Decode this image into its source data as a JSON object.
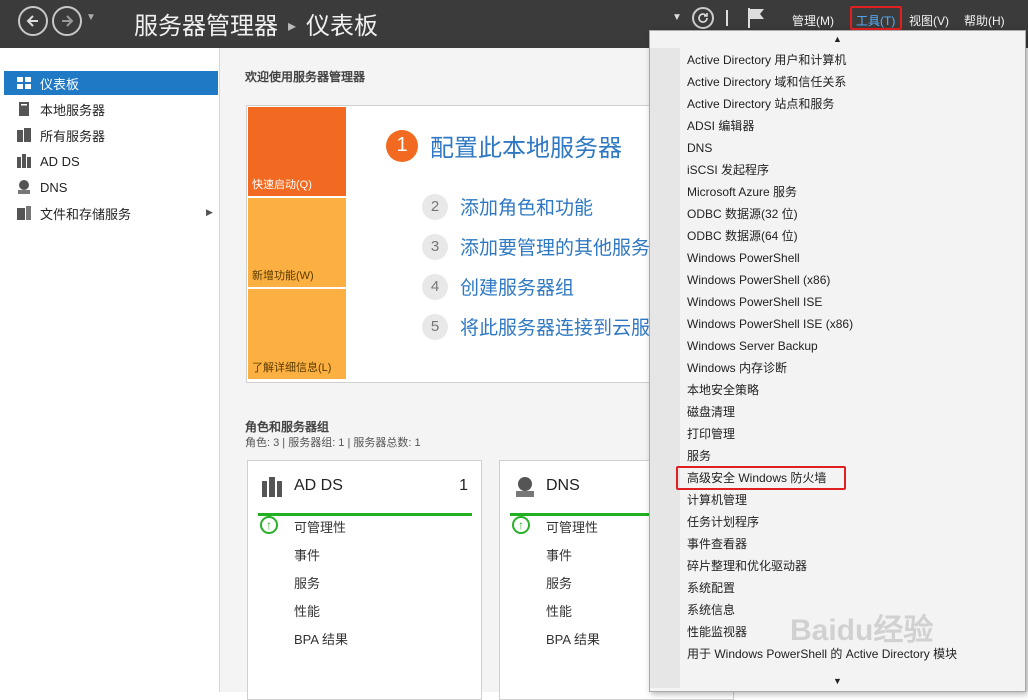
{
  "titlebar": {
    "breadcrumb_root": "服务器管理器",
    "breadcrumb_separator": "▸",
    "breadcrumb_page": "仪表板",
    "menus": {
      "manage": "管理(M)",
      "tools": "工具(T)",
      "view": "视图(V)",
      "help": "帮助(H)"
    }
  },
  "sidebar": {
    "items": [
      {
        "label": "仪表板",
        "icon": "dashboard-icon",
        "active": true
      },
      {
        "label": "本地服务器",
        "icon": "server-icon"
      },
      {
        "label": "所有服务器",
        "icon": "servers-icon"
      },
      {
        "label": "AD DS",
        "icon": "ad-ds-icon"
      },
      {
        "label": "DNS",
        "icon": "dns-icon"
      },
      {
        "label": "文件和存储服务",
        "icon": "file-storage-icon",
        "expandable": true
      }
    ]
  },
  "welcome": {
    "title": "欢迎使用服务器管理器",
    "tiles": [
      "快速启动(Q)",
      "新增功能(W)",
      "了解详细信息(L)"
    ],
    "steps": [
      {
        "num": "1",
        "label": "配置此本地服务器"
      },
      {
        "num": "2",
        "label": "添加角色和功能"
      },
      {
        "num": "3",
        "label": "添加要管理的其他服务"
      },
      {
        "num": "4",
        "label": "创建服务器组"
      },
      {
        "num": "5",
        "label": "将此服务器连接到云服"
      }
    ]
  },
  "roles": {
    "title": "角色和服务器组",
    "subtitle": "角色: 3 | 服务器组: 1 | 服务器总数: 1",
    "cards": [
      {
        "name": "AD DS",
        "count": "1",
        "rows": [
          "可管理性",
          "事件",
          "服务",
          "性能",
          "BPA 结果"
        ]
      },
      {
        "name": "DNS",
        "count": "",
        "rows": [
          "可管理性",
          "事件",
          "服务",
          "性能",
          "BPA 结果"
        ]
      }
    ]
  },
  "tools_menu": {
    "items": [
      "Active Directory 用户和计算机",
      "Active Directory 域和信任关系",
      "Active Directory 站点和服务",
      "ADSI 编辑器",
      "DNS",
      "iSCSI 发起程序",
      "Microsoft Azure 服务",
      "ODBC 数据源(32 位)",
      "ODBC 数据源(64 位)",
      "Windows PowerShell",
      "Windows PowerShell (x86)",
      "Windows PowerShell ISE",
      "Windows PowerShell ISE (x86)",
      "Windows Server Backup",
      "Windows 内存诊断",
      "本地安全策略",
      "磁盘清理",
      "打印管理",
      "服务",
      "高级安全 Windows 防火墙",
      "计算机管理",
      "任务计划程序",
      "事件查看器",
      "碎片整理和优化驱动器",
      "系统配置",
      "系统信息",
      "性能监视器",
      "用于 Windows PowerShell 的 Active Directory 模块"
    ],
    "highlighted_item": "高级安全 Windows 防火墙"
  },
  "watermark": "Baidu经验",
  "colors": {
    "titlebar": "#3b3b3b",
    "accent": "#1f79c4",
    "tile_quick": "#f26a21",
    "tile_other": "#fcb041",
    "highlight": "#e02020",
    "status_ok": "#21b020"
  }
}
